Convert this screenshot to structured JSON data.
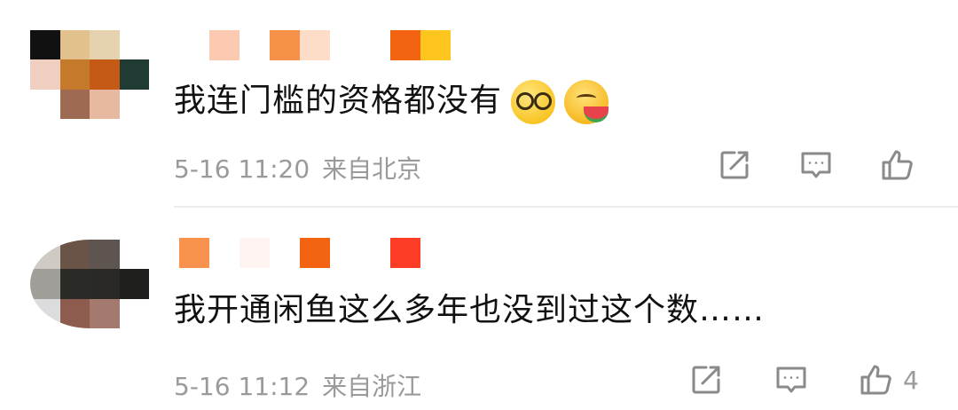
{
  "comments": [
    {
      "text": "我连门槛的资格都没有",
      "emojis": [
        "glasses-emoji",
        "watermelon-emoji"
      ],
      "time": "5-16 11:20",
      "location": "来自北京",
      "like_count": "",
      "avatar_pixels": [
        "#111111",
        "#e2c18c",
        "#e6d2ae",
        "#ffffff",
        "#f0cfc0",
        "#c47a2a",
        "#c45a16",
        "#1f3b34",
        "#ffffff",
        "#9e6a52",
        "#e6b9a0",
        "#ffffff"
      ],
      "name_blocks": [
        "#ffffff",
        "#fbcab0",
        "#ffffff",
        "#f7914a",
        "#fddcc8",
        "#ffffff",
        "#ffffff",
        "#f26411",
        "#ffc51f"
      ]
    },
    {
      "text": "我开通闲鱼这么多年也没到过这个数……",
      "emojis": [],
      "time": "5-16 11:12",
      "location": "来自浙江",
      "like_count": "4",
      "avatar_pixels": [
        "#cfcac4",
        "#6a5347",
        "#5f5550",
        "#ffffff",
        "#a09e98",
        "#2a2a26",
        "#2a2925",
        "#1e1f1c",
        "#dcdcde",
        "#8d5c4e",
        "#a47a6e",
        "#ffffff"
      ],
      "name_blocks": [
        "#f9924c",
        "#ffffff",
        "#fef4f2",
        "#ffffff",
        "#f26411",
        "#ffffff",
        "#ffffff",
        "#fd3d26"
      ]
    }
  ],
  "icons": {
    "share": "share-icon",
    "comment": "comment-icon",
    "like": "like-icon"
  }
}
